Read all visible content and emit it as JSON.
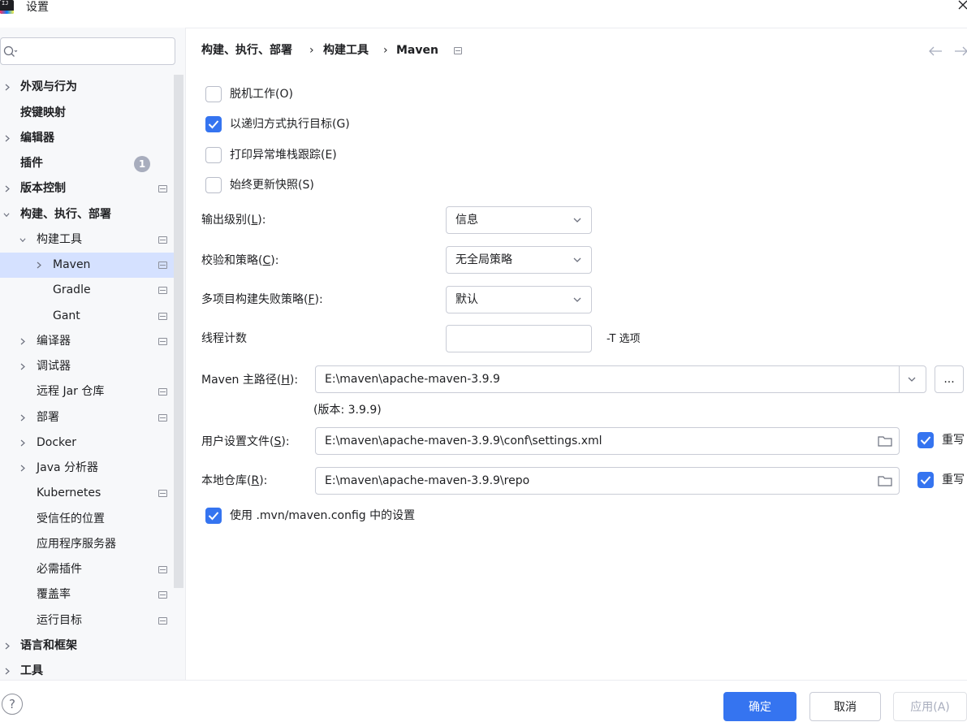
{
  "window": {
    "title": "设置"
  },
  "search": {
    "placeholder": ""
  },
  "sidebar": {
    "items": [
      {
        "label": "外观与行为"
      },
      {
        "label": "按键映射"
      },
      {
        "label": "编辑器"
      },
      {
        "label": "插件",
        "badge": "1"
      },
      {
        "label": "版本控制"
      },
      {
        "label": "构建、执行、部署"
      },
      {
        "label": "构建工具"
      },
      {
        "label": "Maven"
      },
      {
        "label": "Gradle"
      },
      {
        "label": "Gant"
      },
      {
        "label": "编译器"
      },
      {
        "label": "调试器"
      },
      {
        "label": "远程 Jar 仓库"
      },
      {
        "label": "部署"
      },
      {
        "label": "Docker"
      },
      {
        "label": "Java 分析器"
      },
      {
        "label": "Kubernetes"
      },
      {
        "label": "受信任的位置"
      },
      {
        "label": "应用程序服务器"
      },
      {
        "label": "必需插件"
      },
      {
        "label": "覆盖率"
      },
      {
        "label": "运行目标"
      },
      {
        "label": "语言和框架"
      },
      {
        "label": "工具"
      }
    ]
  },
  "breadcrumb": [
    "构建、执行、部署",
    "构建工具",
    "Maven"
  ],
  "breadcrumb_sep": "›",
  "options": {
    "offline": {
      "label": "脱机工作(O)",
      "checked": false
    },
    "recursive": {
      "label": "以递归方式执行目标(G)",
      "checked": true
    },
    "print_stack": {
      "label": "打印异常堆栈跟踪(E)",
      "checked": false
    },
    "update_snapshots": {
      "label": "始终更新快照(S)",
      "checked": false
    }
  },
  "fields": {
    "output_level": {
      "label_pre": "输出级别(",
      "mnemonic": "L",
      "label_post": "):",
      "value": "信息"
    },
    "checksum_policy": {
      "label_pre": "校验和策略(",
      "mnemonic": "C",
      "label_post": "):",
      "value": "无全局策略"
    },
    "fail_policy": {
      "label_pre": "多项目构建失败策略(",
      "mnemonic": "F",
      "label_post": "):",
      "value": "默认"
    },
    "threads": {
      "label": "线程计数",
      "value": "",
      "hint": "-T 选项"
    },
    "maven_home": {
      "label_pre": "Maven 主路径(",
      "mnemonic": "H",
      "label_post": "):",
      "value": "E:\\maven\\apache-maven-3.9.9",
      "version": "(版本: 3.9.9)",
      "browse": "..."
    },
    "user_settings": {
      "label_pre": "用户设置文件(",
      "mnemonic": "S",
      "label_post": "):",
      "value": "E:\\maven\\apache-maven-3.9.9\\conf\\settings.xml",
      "override_label": "重写",
      "override_checked": true
    },
    "local_repo": {
      "label_pre": "本地仓库(",
      "mnemonic": "R",
      "label_post": "):",
      "value": "E:\\maven\\apache-maven-3.9.9\\repo",
      "override_label": "重写",
      "override_checked": true
    },
    "use_mvn_config": {
      "label": "使用 .mvn/maven.config 中的设置",
      "checked": true
    }
  },
  "buttons": {
    "ok": "确定",
    "cancel": "取消",
    "apply": "应用(A)",
    "help": "?"
  },
  "colors": {
    "accent": "#3574f0",
    "selection": "#d5e1ff",
    "sidebar_bg": "#f7f8fa"
  }
}
